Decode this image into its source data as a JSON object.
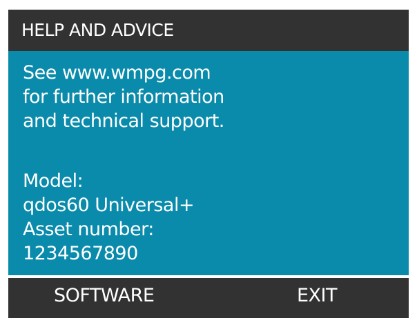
{
  "header": {
    "title": "HELP AND ADVICE"
  },
  "content": {
    "info_line_1": "See www.wmpg.com",
    "info_line_2": "for further information",
    "info_line_3": "and technical support.",
    "model_label": "Model:",
    "model_value": "qdos60 Universal+",
    "asset_label": "Asset number:",
    "asset_value": "1234567890"
  },
  "softkeys": {
    "left_label": "SOFTWARE",
    "right_label": "EXIT"
  },
  "colors": {
    "header_background": "#323232",
    "content_background": "#0a8bab",
    "text": "#ffffff",
    "frame": "#1a1a1a"
  }
}
